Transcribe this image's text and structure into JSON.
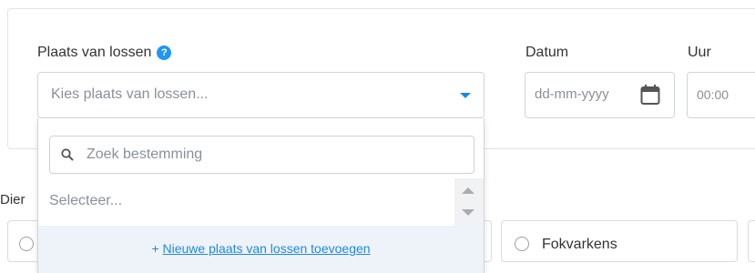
{
  "form": {
    "location_label": "Plaats van lossen",
    "help_glyph": "?",
    "location_placeholder": "Kies plaats van lossen...",
    "date_label": "Datum",
    "date_placeholder": "dd-mm-yyyy",
    "time_label": "Uur",
    "time_placeholder": "00:00"
  },
  "dropdown": {
    "search_placeholder": "Zoek bestemming",
    "options": [
      "Selecteer..."
    ],
    "add_prefix": "+",
    "add_link": "Nieuwe plaats van lossen toevoegen"
  },
  "animals": {
    "label_partial": "Dier",
    "options": [
      "",
      "Fokvarkens"
    ]
  },
  "colors": {
    "accent": "#1e88e5",
    "help_badge": "#2196f3",
    "dropdown_footer_bg": "#eef3fa"
  },
  "icons": [
    "help-icon",
    "chevron-down-icon",
    "calendar-icon",
    "search-icon",
    "scroll-up-icon",
    "scroll-down-icon"
  ]
}
